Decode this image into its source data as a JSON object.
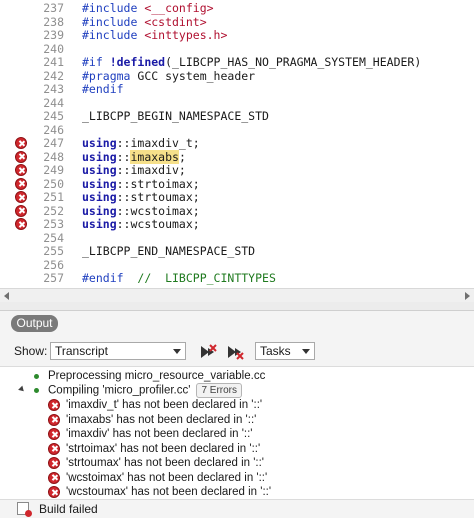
{
  "editor": {
    "lines": [
      {
        "num": "237",
        "error": false,
        "parts": [
          [
            "dir",
            "#include "
          ],
          [
            "str",
            "<__config>"
          ]
        ]
      },
      {
        "num": "238",
        "error": false,
        "parts": [
          [
            "dir",
            "#include "
          ],
          [
            "str",
            "<cstdint>"
          ]
        ]
      },
      {
        "num": "239",
        "error": false,
        "parts": [
          [
            "dir",
            "#include "
          ],
          [
            "str",
            "<inttypes.h>"
          ]
        ]
      },
      {
        "num": "240",
        "error": false,
        "parts": []
      },
      {
        "num": "241",
        "error": false,
        "parts": [
          [
            "dir",
            "#if "
          ],
          [
            "kw",
            "!defined"
          ],
          [
            "txt",
            "(_LIBCPP_HAS_NO_PRAGMA_SYSTEM_HEADER)"
          ]
        ]
      },
      {
        "num": "242",
        "error": false,
        "parts": [
          [
            "dir",
            "#pragma "
          ],
          [
            "txt",
            "GCC system_header"
          ]
        ]
      },
      {
        "num": "243",
        "error": false,
        "parts": [
          [
            "dir",
            "#endif"
          ]
        ]
      },
      {
        "num": "244",
        "error": false,
        "parts": []
      },
      {
        "num": "245",
        "error": false,
        "parts": [
          [
            "txt",
            "_LIBCPP_BEGIN_NAMESPACE_STD"
          ]
        ]
      },
      {
        "num": "246",
        "error": false,
        "parts": []
      },
      {
        "num": "247",
        "error": true,
        "parts": [
          [
            "kw",
            "using"
          ],
          [
            "txt",
            "::imaxdiv_t;"
          ]
        ]
      },
      {
        "num": "248",
        "error": true,
        "parts": [
          [
            "kw",
            "using"
          ],
          [
            "txt",
            "::"
          ],
          [
            "hl",
            "imaxabs"
          ],
          [
            "txt",
            ";"
          ]
        ]
      },
      {
        "num": "249",
        "error": true,
        "parts": [
          [
            "kw",
            "using"
          ],
          [
            "txt",
            "::imaxdiv;"
          ]
        ]
      },
      {
        "num": "250",
        "error": true,
        "parts": [
          [
            "kw",
            "using"
          ],
          [
            "txt",
            "::strtoimax;"
          ]
        ]
      },
      {
        "num": "251",
        "error": true,
        "parts": [
          [
            "kw",
            "using"
          ],
          [
            "txt",
            "::strtoumax;"
          ]
        ]
      },
      {
        "num": "252",
        "error": true,
        "parts": [
          [
            "kw",
            "using"
          ],
          [
            "txt",
            "::wcstoimax;"
          ]
        ]
      },
      {
        "num": "253",
        "error": true,
        "parts": [
          [
            "kw",
            "using"
          ],
          [
            "txt",
            "::wcstoumax;"
          ]
        ]
      },
      {
        "num": "254",
        "error": false,
        "parts": []
      },
      {
        "num": "255",
        "error": false,
        "parts": [
          [
            "txt",
            "_LIBCPP_END_NAMESPACE_STD"
          ]
        ]
      },
      {
        "num": "256",
        "error": false,
        "parts": []
      },
      {
        "num": "257",
        "error": false,
        "parts": [
          [
            "dir",
            "#endif  "
          ],
          [
            "cm",
            "//  LIBCPP_CINTTYPES"
          ]
        ]
      }
    ]
  },
  "output_panel": {
    "tab_label": "Output",
    "show_label": "Show:",
    "show_value": "Transcript",
    "tasks_value": "Tasks",
    "rows": [
      {
        "type": "info",
        "text": "Preprocessing micro_resource_variable.cc"
      },
      {
        "type": "group",
        "text": "Compiling 'micro_profiler.cc'",
        "badge": "7 Errors"
      },
      {
        "type": "error",
        "text": "'imaxdiv_t' has not been declared in '::'"
      },
      {
        "type": "error",
        "text": "'imaxabs' has not been declared in '::'"
      },
      {
        "type": "error",
        "text": "'imaxdiv' has not been declared in '::'"
      },
      {
        "type": "error",
        "text": "'strtoimax' has not been declared in '::'"
      },
      {
        "type": "error",
        "text": "'strtoumax' has not been declared in '::'"
      },
      {
        "type": "error",
        "text": "'wcstoimax' has not been declared in '::'"
      },
      {
        "type": "error",
        "text": "'wcstoumax' has not been declared in '::'"
      }
    ],
    "status_text": "Build failed"
  },
  "colors": {
    "error_red": "#d0272d",
    "directive_blue": "#1f3fbf",
    "string_red": "#b01030",
    "highlight": "#f6e08a"
  }
}
